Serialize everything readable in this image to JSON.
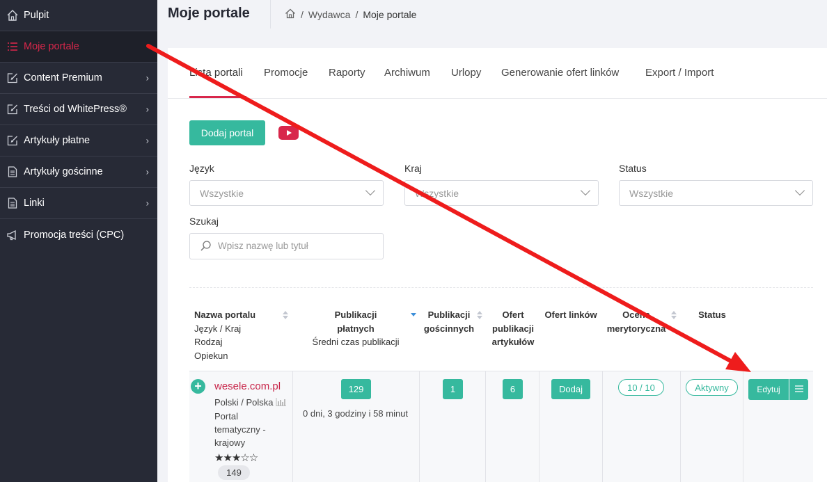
{
  "sidebar": {
    "items": [
      {
        "label": "Pulpit",
        "icon": "home-icon"
      },
      {
        "label": "Moje portale",
        "icon": "list-icon",
        "active": true
      },
      {
        "label": "Content Premium",
        "icon": "edit-icon"
      },
      {
        "label": "Treści od WhitePress®",
        "icon": "edit-icon"
      },
      {
        "label": "Artykuły płatne",
        "icon": "edit-icon"
      },
      {
        "label": "Artykuły gościnne",
        "icon": "document-icon"
      },
      {
        "label": "Linki",
        "icon": "document-icon"
      },
      {
        "label": "Promocja treści (CPC)",
        "icon": "megaphone-icon"
      }
    ]
  },
  "header": {
    "title": "Moje portale",
    "breadcrumb": [
      "Wydawca",
      "Moje portale"
    ],
    "breadcrumb_sep": "/"
  },
  "tabs": [
    "Lista portali",
    "Promocje",
    "Raporty",
    "Archiwum",
    "Urlopy",
    "Generowanie ofert linków",
    "Export / Import"
  ],
  "actions": {
    "add_portal": "Dodaj portal"
  },
  "filters": {
    "language": {
      "label": "Język",
      "value": "Wszystkie"
    },
    "country": {
      "label": "Kraj",
      "value": "Wszystkie"
    },
    "status": {
      "label": "Status",
      "value": "Wszystkie"
    },
    "search": {
      "label": "Szukaj",
      "placeholder": "Wpisz nazwę lub tytuł"
    }
  },
  "table": {
    "headers": {
      "name": [
        "Nazwa portalu",
        "Język / Kraj",
        "Rodzaj",
        "Opiekun"
      ],
      "paid": [
        "Publikacji",
        "płatnych",
        "Średni czas publikacji"
      ],
      "guest": [
        "Publikacji",
        "gościnnych"
      ],
      "offers": [
        "Ofert",
        "publikacji",
        "artykułów"
      ],
      "links": "Ofert linków",
      "rating": [
        "Ocena",
        "merytoryczna"
      ],
      "status": "Status"
    },
    "row": {
      "portal": "wesele.com.pl",
      "lang_country": "Polski / Polska",
      "type": [
        "Portal",
        "tematyczny -",
        "krajowy"
      ],
      "stars": "★★★☆☆",
      "rating_count": "149",
      "paid": "129",
      "avg_time": "0 dni, 3 godziny i 58 minut",
      "guest": "1",
      "offers": "6",
      "links": "Dodaj",
      "rating": "10 / 10",
      "status": "Aktywny",
      "edit": "Edytuj"
    }
  },
  "colors": {
    "accent": "#d8274b",
    "green": "#36b99e",
    "sidebar": "#272a36",
    "arrow": "#ee1c1c"
  }
}
